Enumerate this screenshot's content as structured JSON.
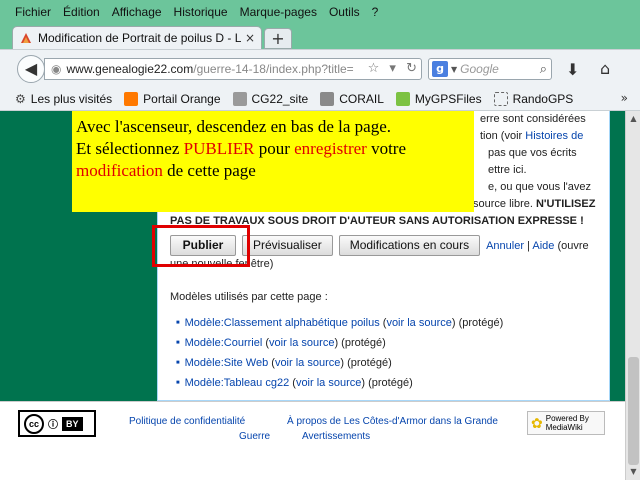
{
  "menu": [
    "Fichier",
    "Édition",
    "Affichage",
    "Historique",
    "Marque-pages",
    "Outils",
    "?"
  ],
  "tab": {
    "title": "Modification de Portrait de poilus D - Le...",
    "close": "×",
    "new": "+"
  },
  "nav": {
    "url_host": "www.genealogie22.com",
    "url_rest": "/guerre-14-18/index.php?title=",
    "search_placeholder": "Google"
  },
  "bookmarks": [
    "Les plus visités",
    "Portail Orange",
    "CG22_site",
    "CORAIL",
    "MyGPSFiles",
    "RandoGPS"
  ],
  "page": {
    "line1": "erre sont considérées",
    "line2a": "tion (voir ",
    "line2b": "Histoires de",
    "line3": "pas que vos écrits",
    "line4": "ettre ici.",
    "line5": "e, ou que vous l'avez",
    "line6a": "source libre. ",
    "line6b": "N'UTILISEZ",
    "line7": "PAS DE TRAVAUX SOUS DROIT D'AUTEUR SANS AUTORISATION EXPRESSE !",
    "btn_publish": "Publier",
    "btn_preview": "Prévisualiser",
    "btn_changes": "Modifications en cours",
    "cancel": "Annuler",
    "sep": " | ",
    "help": "Aide",
    "help_tail": " (ouvre",
    "help_line2": "une nouvelle fenêtre)",
    "templates_title": "Modèles utilisés par cette page :",
    "templates": [
      {
        "name": "Modèle:Classement alphabétique poilus",
        "source": "voir la source",
        "status": "(protégé)"
      },
      {
        "name": "Modèle:Courriel",
        "source": "voir la source",
        "status": "(protégé)"
      },
      {
        "name": "Modèle:Site Web",
        "source": "voir la source",
        "status": "(protégé)"
      },
      {
        "name": "Modèle:Tableau cg22",
        "source": "voir la source",
        "status": "(protégé)"
      }
    ]
  },
  "callout": {
    "l1": "Avec l'ascenseur, descendez en bas de la page.",
    "l2a": "Et sélectionnez ",
    "l2b": "PUBLIER",
    "l2c": " pour ",
    "l2d": "enregistrer",
    "l2e": " votre",
    "l3a": "modification",
    "l3b": " de cette page"
  },
  "footer": {
    "privacy": "Politique de confidentialité",
    "about1": "À propos de Les Côtes-d'Armor dans la Grande",
    "about2": "Guerre",
    "disclaimers": "Avertissements",
    "cc_label": "cc",
    "cc_by": "BY",
    "mw_label": "Powered By MediaWiki"
  }
}
